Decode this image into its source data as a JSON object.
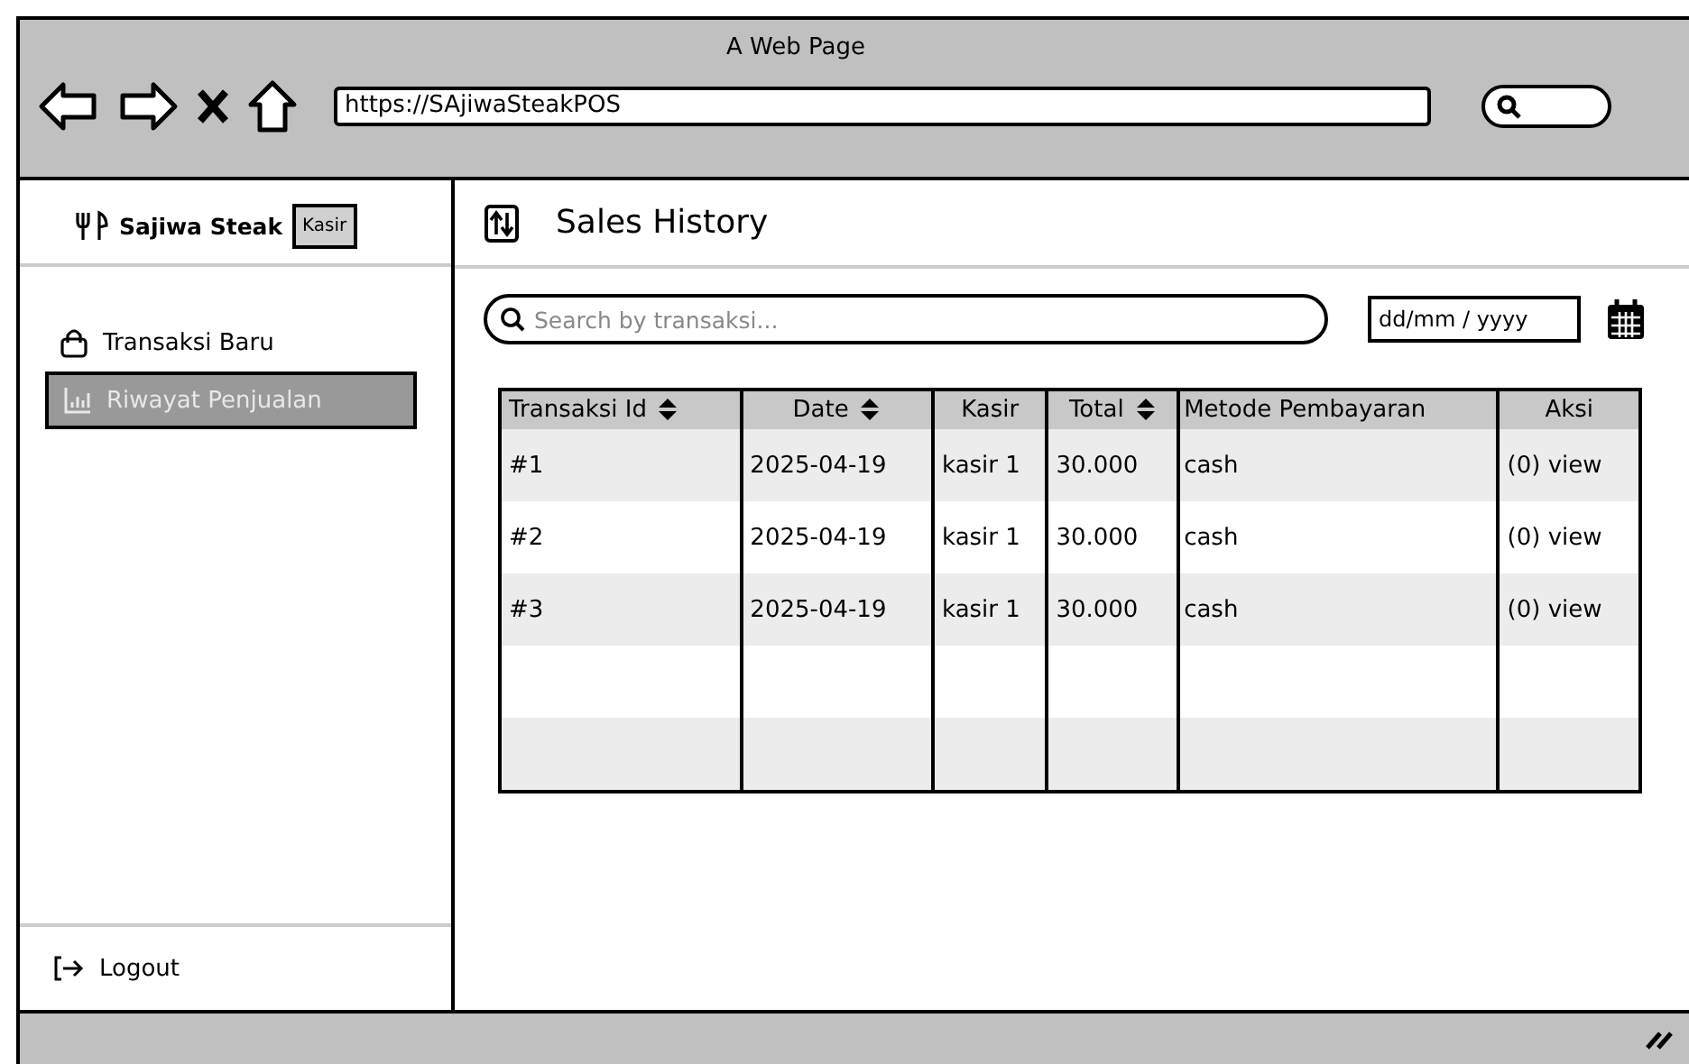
{
  "window": {
    "title": "A Web Page",
    "url": "https://SAjiwaSteakPOS"
  },
  "sidebar": {
    "brand": "Sajiwa Steak",
    "role_badge": "Kasir",
    "items": [
      {
        "label": "Transaksi Baru",
        "selected": false
      },
      {
        "label": "Riwayat Penjualan",
        "selected": true
      }
    ],
    "logout": "Logout"
  },
  "page": {
    "title": "Sales History",
    "search": {
      "placeholder": "Search by transaksi..."
    },
    "date_field": {
      "value": "dd/mm / yyyy"
    }
  },
  "table": {
    "columns": [
      {
        "label": "Transaksi Id",
        "sortable": true
      },
      {
        "label": "Date",
        "sortable": true
      },
      {
        "label": "Kasir",
        "sortable": false
      },
      {
        "label": "Total",
        "sortable": true
      },
      {
        "label": "Metode Pembayaran",
        "sortable": false
      },
      {
        "label": "Aksi",
        "sortable": false
      }
    ],
    "rows": [
      [
        "#1",
        "2025-04-19",
        "kasir 1",
        "30.000",
        "cash",
        "(0) view"
      ],
      [
        "#2",
        "2025-04-19",
        "kasir 1",
        "30.000",
        "cash",
        "(0) view"
      ],
      [
        "#3",
        "2025-04-19",
        "kasir 1",
        "30.000",
        "cash",
        "(0) view"
      ]
    ]
  }
}
